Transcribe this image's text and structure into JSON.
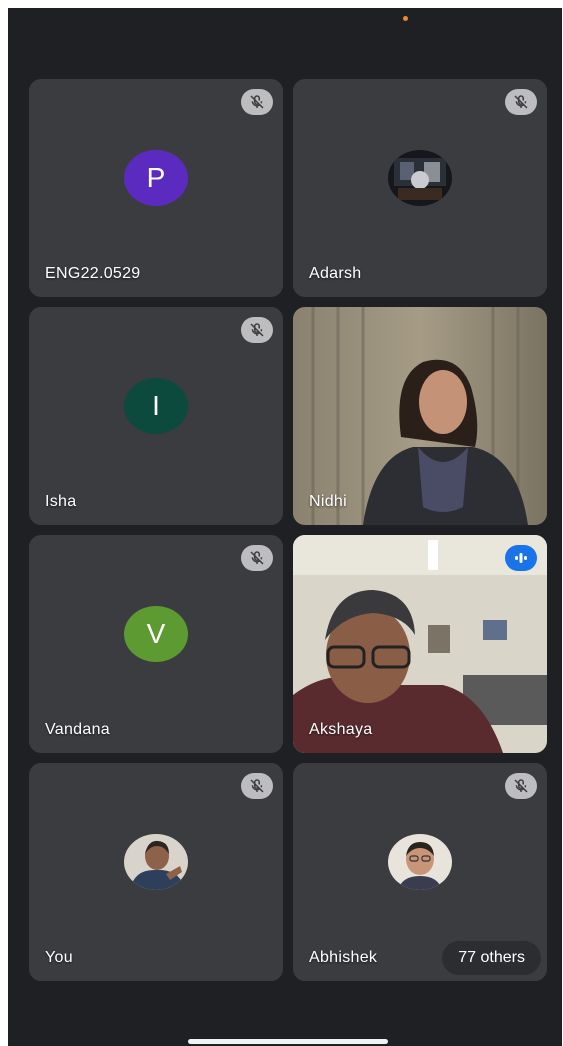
{
  "participants": [
    {
      "name": "ENG22.0529",
      "avatar_type": "letter",
      "avatar_letter": "P",
      "avatar_color": "#5b2bbf",
      "muted": true
    },
    {
      "name": "Adarsh",
      "avatar_type": "photo",
      "muted": true
    },
    {
      "name": "Isha",
      "avatar_type": "letter",
      "avatar_letter": "I",
      "avatar_color": "#0c4a3d",
      "muted": true
    },
    {
      "name": "Nidhi",
      "avatar_type": "video",
      "muted": false
    },
    {
      "name": "Vandana",
      "avatar_type": "letter",
      "avatar_letter": "V",
      "avatar_color": "#5d9a31",
      "muted": true
    },
    {
      "name": "Akshaya",
      "avatar_type": "video",
      "muted": false,
      "speaking": true
    },
    {
      "name": "You",
      "avatar_type": "photo",
      "muted": true
    },
    {
      "name": "Abhishek",
      "avatar_type": "photo",
      "muted": true
    }
  ],
  "others": {
    "label": "77 others"
  },
  "icons": {
    "mute": "mic-off-icon",
    "speaking": "audio-level-icon"
  },
  "colors": {
    "background": "#1f2023",
    "tile": "#3b3c40",
    "mute_badge": "#bdbdc0",
    "speaking_badge": "#1a73e8"
  }
}
